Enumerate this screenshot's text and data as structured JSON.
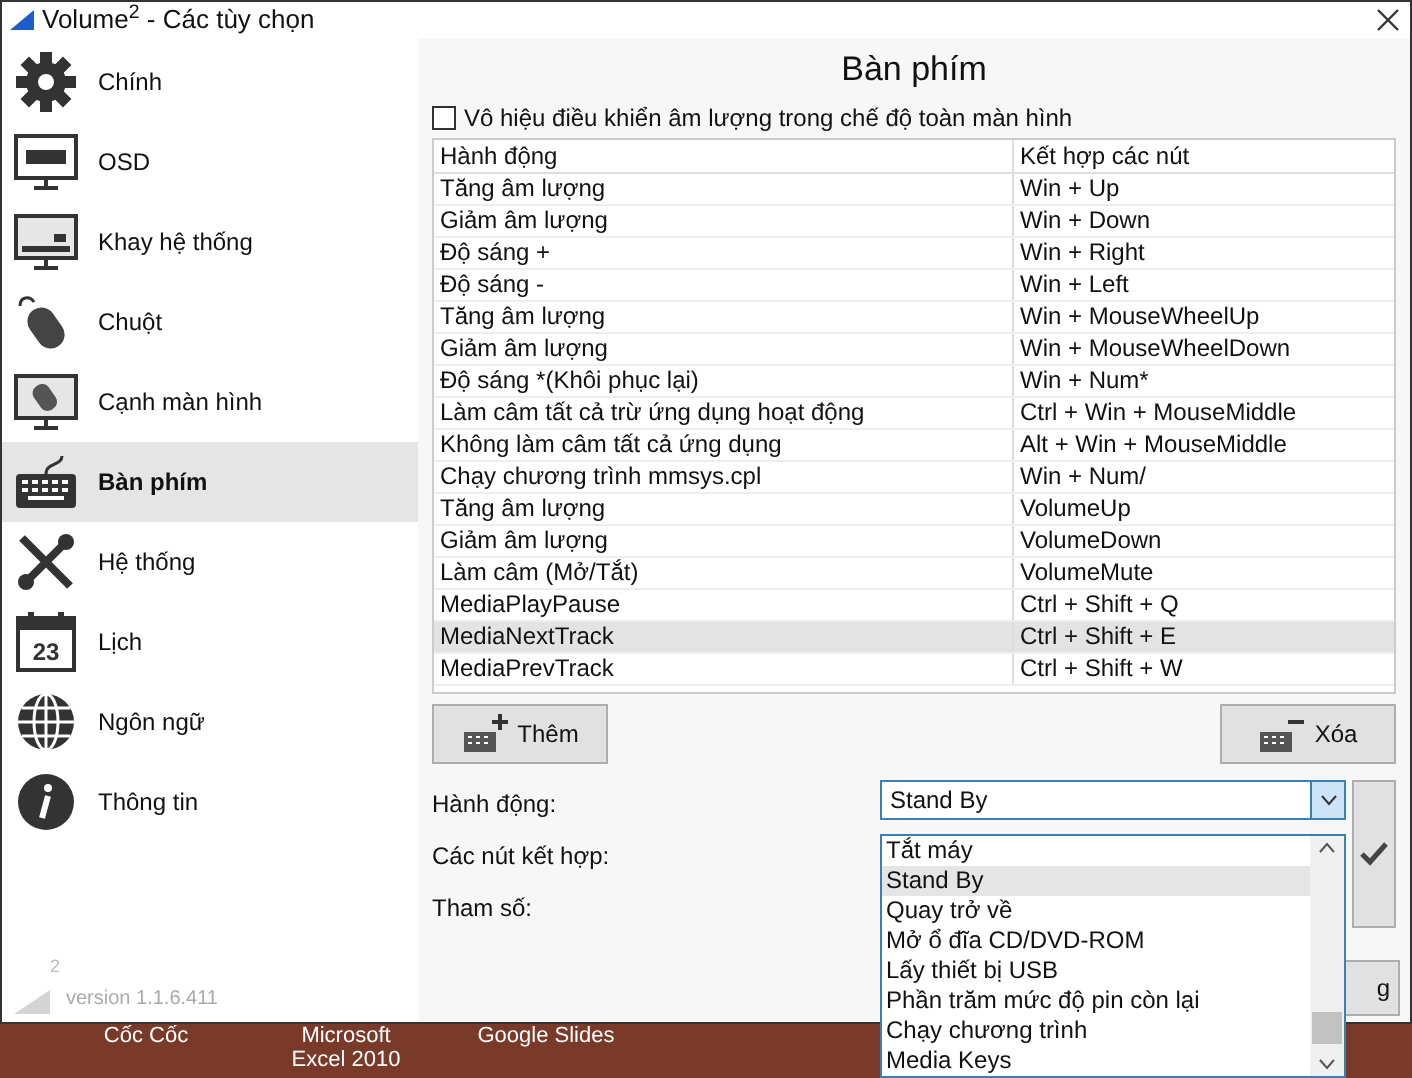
{
  "window": {
    "title": "Volume$^{2}$ - Các tùy chọn"
  },
  "sidebar": {
    "items": [
      {
        "label": "Chính",
        "selected": false
      },
      {
        "label": "OSD",
        "selected": false
      },
      {
        "label": "Khay hệ thống",
        "selected": false
      },
      {
        "label": "Chuột",
        "selected": false
      },
      {
        "label": "Cạnh màn hình",
        "selected": false
      },
      {
        "label": "Bàn phím",
        "selected": true
      },
      {
        "label": "Hệ thống",
        "selected": false
      },
      {
        "label": "Lịch",
        "icon_text": "23",
        "selected": false
      },
      {
        "label": "Ngôn ngữ",
        "selected": false
      },
      {
        "label": "Thông tin",
        "selected": false
      }
    ],
    "logo_mark": "2",
    "version": "version 1.1.6.411"
  },
  "panel": {
    "heading": "Bàn phím",
    "fullscreen_checkbox": {
      "label": "Vô hiệu điều khiển âm lượng trong chế độ toàn màn hình",
      "checked": false
    },
    "table": {
      "columns": [
        "Hành động",
        "Kết hợp các nút"
      ],
      "rows": [
        {
          "action": "Tăng âm lượng",
          "keys": "Win + Up",
          "selected": false
        },
        {
          "action": "Giảm âm lượng",
          "keys": "Win + Down",
          "selected": false
        },
        {
          "action": "Độ sáng +",
          "keys": "Win + Right",
          "selected": false
        },
        {
          "action": "Độ sáng -",
          "keys": "Win + Left",
          "selected": false
        },
        {
          "action": "Tăng âm lượng",
          "keys": "Win + MouseWheelUp",
          "selected": false
        },
        {
          "action": "Giảm âm lượng",
          "keys": "Win + MouseWheelDown",
          "selected": false
        },
        {
          "action": "Độ sáng *(Khôi phục lại)",
          "keys": "Win + Num*",
          "selected": false
        },
        {
          "action": "Làm câm tất cả trừ ứng dụng hoạt động",
          "keys": "Ctrl + Win + MouseMiddle",
          "selected": false
        },
        {
          "action": "Không làm câm tất cả ứng dụng",
          "keys": "Alt + Win + MouseMiddle",
          "selected": false
        },
        {
          "action": "Chạy chương trình mmsys.cpl",
          "keys": "Win + Num/",
          "selected": false
        },
        {
          "action": "Tăng âm lượng",
          "keys": "VolumeUp",
          "selected": false
        },
        {
          "action": "Giảm âm lượng",
          "keys": "VolumeDown",
          "selected": false
        },
        {
          "action": "Làm câm (Mở/Tắt)",
          "keys": "VolumeMute",
          "selected": false
        },
        {
          "action": "MediaPlayPause",
          "keys": "Ctrl + Shift + Q",
          "selected": false
        },
        {
          "action": "MediaNextTrack",
          "keys": "Ctrl + Shift + E",
          "selected": true
        },
        {
          "action": "MediaPrevTrack",
          "keys": "Ctrl + Shift + W",
          "selected": false
        }
      ]
    },
    "add_button": "Thêm",
    "delete_button": "Xóa",
    "form": {
      "labels": [
        "Hành động:",
        "Các nút kết hợp:",
        "Tham số:"
      ],
      "action_dropdown": {
        "value": "Stand By",
        "options": [
          {
            "label": "Tắt máy",
            "selected": false
          },
          {
            "label": "Stand By",
            "selected": true
          },
          {
            "label": "Quay trở về",
            "selected": false
          },
          {
            "label": "Mở ổ đĩa CD/DVD-ROM",
            "selected": false
          },
          {
            "label": "Lấy thiết bị USB",
            "selected": false
          },
          {
            "label": "Phần trăm mức độ pin còn lại",
            "selected": false
          },
          {
            "label": "Chạy chương trình",
            "selected": false
          },
          {
            "label": "Media Keys",
            "selected": false
          }
        ]
      }
    },
    "hidden_button_text": "g"
  },
  "desktop": {
    "icons": [
      "Cốc Cốc",
      "Microsoft Excel 2010",
      "Google Slides"
    ]
  }
}
